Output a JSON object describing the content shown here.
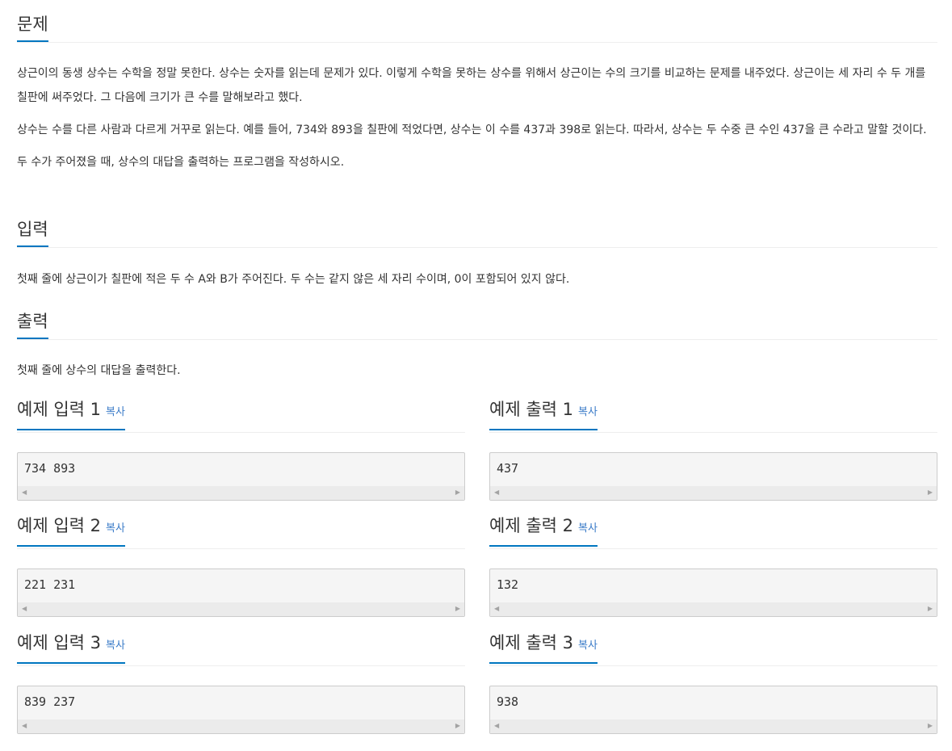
{
  "problem": {
    "heading": "문제",
    "paragraphs": [
      "상근이의 동생 상수는 수학을 정말 못한다. 상수는 숫자를 읽는데 문제가 있다. 이렇게 수학을 못하는 상수를 위해서 상근이는 수의 크기를 비교하는 문제를 내주었다. 상근이는 세 자리 수 두 개를 칠판에 써주었다. 그 다음에 크기가 큰 수를 말해보라고 했다.",
      "상수는 수를 다른 사람과 다르게 거꾸로 읽는다. 예를 들어, 734와 893을 칠판에 적었다면, 상수는 이 수를 437과 398로 읽는다. 따라서, 상수는 두 수중 큰 수인 437을 큰 수라고 말할 것이다.",
      "두 수가 주어졌을 때, 상수의 대답을 출력하는 프로그램을 작성하시오."
    ]
  },
  "input": {
    "heading": "입력",
    "text": "첫째 줄에 상근이가 칠판에 적은 두 수 A와 B가 주어진다. 두 수는 같지 않은 세 자리 수이며, 0이 포함되어 있지 않다."
  },
  "output": {
    "heading": "출력",
    "text": "첫째 줄에 상수의 대답을 출력한다."
  },
  "copy_label": "복사",
  "scroll_left_icon": "◀",
  "scroll_right_icon": "▶",
  "samples": [
    {
      "input_title": "예제 입력 1",
      "input_value": "734 893",
      "output_title": "예제 출력 1",
      "output_value": "437"
    },
    {
      "input_title": "예제 입력 2",
      "input_value": "221 231",
      "output_title": "예제 출력 2",
      "output_value": "132"
    },
    {
      "input_title": "예제 입력 3",
      "input_value": "839 237",
      "output_title": "예제 출력 3",
      "output_value": "938"
    }
  ]
}
